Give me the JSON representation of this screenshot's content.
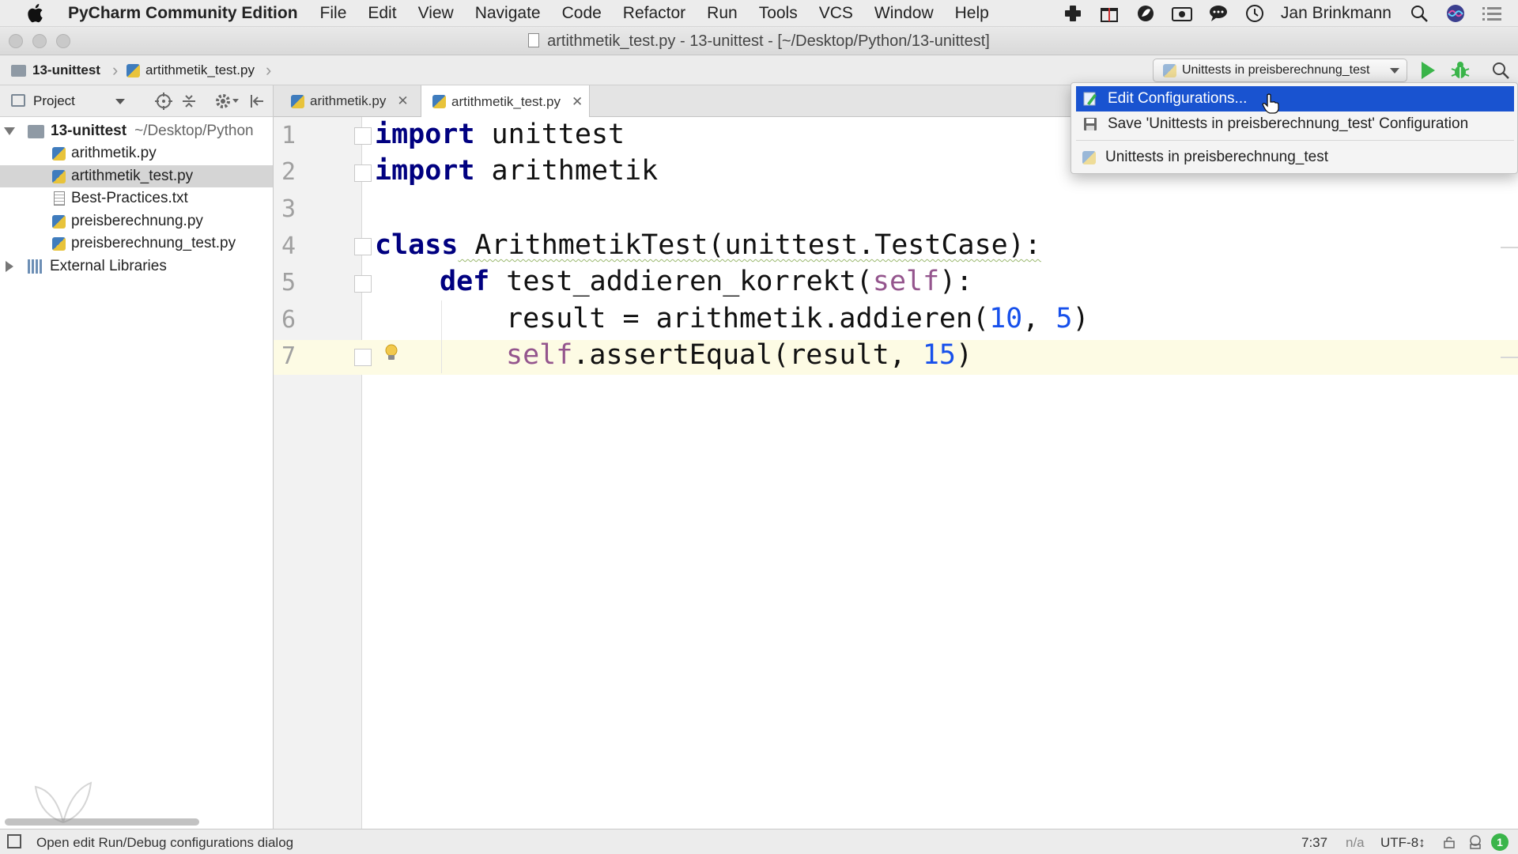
{
  "menubar": {
    "app_name": "PyCharm Community Edition",
    "items": [
      "File",
      "Edit",
      "View",
      "Navigate",
      "Code",
      "Refactor",
      "Run",
      "Tools",
      "VCS",
      "Window",
      "Help"
    ],
    "user": "Jan Brinkmann"
  },
  "window": {
    "title": "artithmetik_test.py - 13-unittest - [~/Desktop/Python/13-unittest]"
  },
  "navbar": {
    "crumb_project": "13-unittest",
    "crumb_file": "artithmetik_test.py",
    "run_config": "Unittests in preisberechnung_test"
  },
  "project_panel": {
    "title": "Project",
    "root_name": "13-unittest",
    "root_path": "~/Desktop/Python",
    "files": [
      "arithmetik.py",
      "artithmetik_test.py",
      "Best-Practices.txt",
      "preisberechnung.py",
      "preisberechnung_test.py"
    ],
    "selected_file": "artithmetik_test.py",
    "external": "External Libraries"
  },
  "tabs": [
    {
      "label": "arithmetik.py",
      "active": false
    },
    {
      "label": "artithmetik_test.py",
      "active": true
    }
  ],
  "editor": {
    "line_numbers": [
      "1",
      "2",
      "3",
      "4",
      "5",
      "6",
      "7"
    ],
    "current_line": 7,
    "code": {
      "l1_kw": "import",
      "l1_rest": " unittest",
      "l2_kw": "import",
      "l2_rest": " arithmetik",
      "l4_kw": "class",
      "l4_rest": " ArithmetikTest(unittest.TestCase):",
      "l5_kw": "def",
      "l5_name": " test_addieren_korrekt(",
      "l5_self": "self",
      "l5_end": "):",
      "l6_a": "result = arithmetik.addieren(",
      "l6_n1": "10",
      "l6_b": ", ",
      "l6_n2": "5",
      "l6_c": ")",
      "l7_self": "self",
      "l7_a": ".assertEqual(result, ",
      "l7_n": "15",
      "l7_c": ")"
    }
  },
  "run_popup": {
    "items": [
      "Edit Configurations...",
      "Save 'Unittests in preisberechnung_test' Configuration",
      "Unittests in preisberechnung_test"
    ],
    "highlighted_index": 0
  },
  "statusbar": {
    "message": "Open edit Run/Debug configurations dialog",
    "position": "7:37",
    "line_sep": "n/a",
    "encoding": "UTF-8↕",
    "notifications": "1"
  },
  "colors": {
    "keyword": "#000080",
    "self": "#94558d",
    "number": "#1750eb",
    "selection": "#1953d0",
    "run_green": "#3ab54a"
  }
}
